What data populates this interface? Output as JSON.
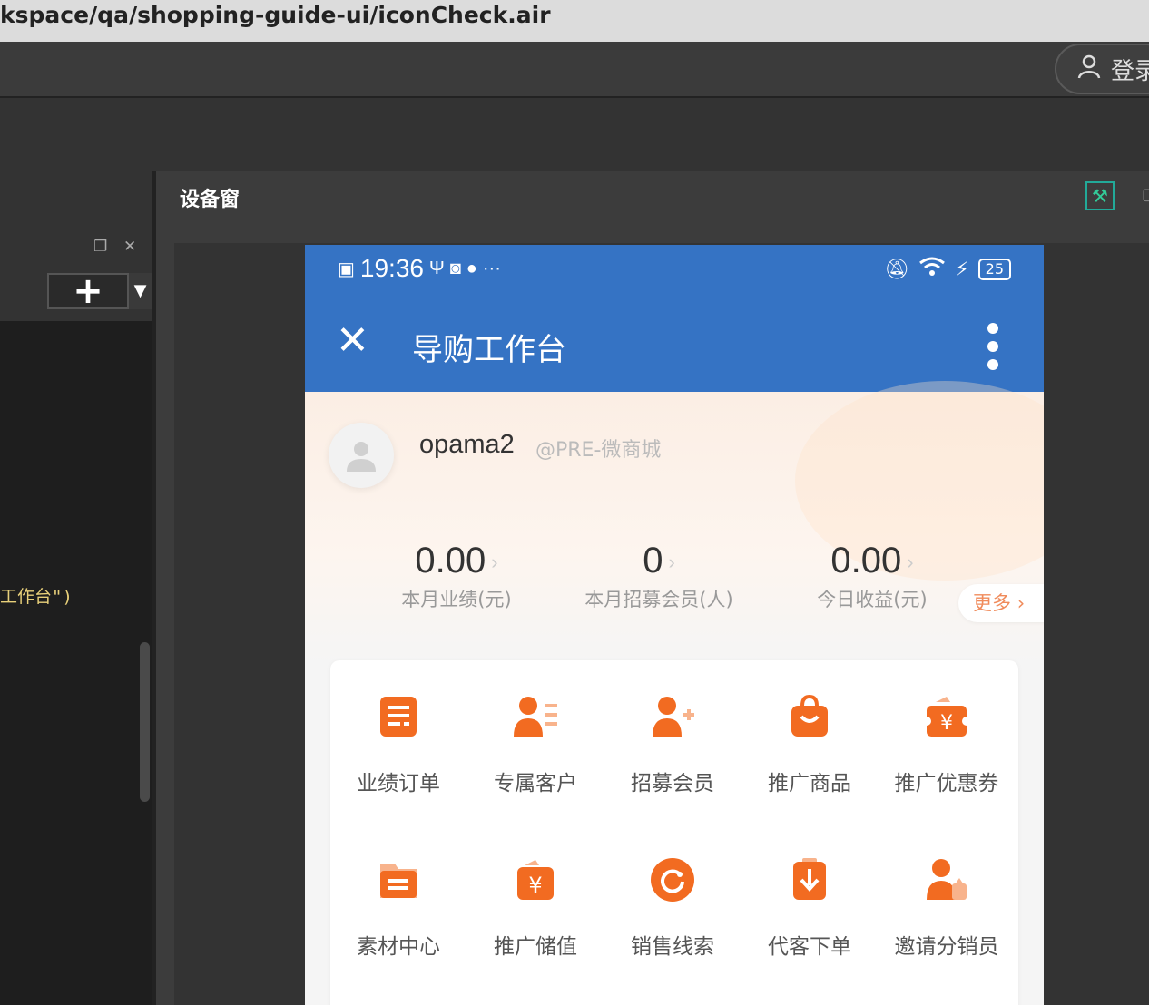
{
  "window": {
    "path_title": "kspace/qa/shopping-guide-ui/iconCheck.air",
    "login_label": "登录"
  },
  "left_panel": {
    "code_snippet": "工作台\")"
  },
  "device_window": {
    "title": "设备窗"
  },
  "phone": {
    "status": {
      "time": "19:36",
      "battery": "25"
    },
    "appbar": {
      "title": "导购工作台"
    },
    "profile": {
      "username": "opama2",
      "shop": "@PRE-微商城"
    },
    "stats": [
      {
        "value": "0.00",
        "label": "本月业绩(元)"
      },
      {
        "value": "0",
        "label": "本月招募会员(人)"
      },
      {
        "value": "0.00",
        "label": "今日收益(元)"
      }
    ],
    "more_label": "更多",
    "grid": [
      {
        "label": "业绩订单",
        "icon": "order-list-icon"
      },
      {
        "label": "专属客户",
        "icon": "customer-icon"
      },
      {
        "label": "招募会员",
        "icon": "add-member-icon"
      },
      {
        "label": "推广商品",
        "icon": "shopping-bag-icon"
      },
      {
        "label": "推广优惠券",
        "icon": "coupon-icon"
      },
      {
        "label": "素材中心",
        "icon": "folder-icon"
      },
      {
        "label": "推广储值",
        "icon": "stored-value-icon"
      },
      {
        "label": "销售线索",
        "icon": "lead-icon"
      },
      {
        "label": "代客下单",
        "icon": "place-order-icon"
      },
      {
        "label": "邀请分销员",
        "icon": "invite-distributor-icon"
      }
    ],
    "accent_color": "#f26b21",
    "header_color": "#3573c4"
  }
}
